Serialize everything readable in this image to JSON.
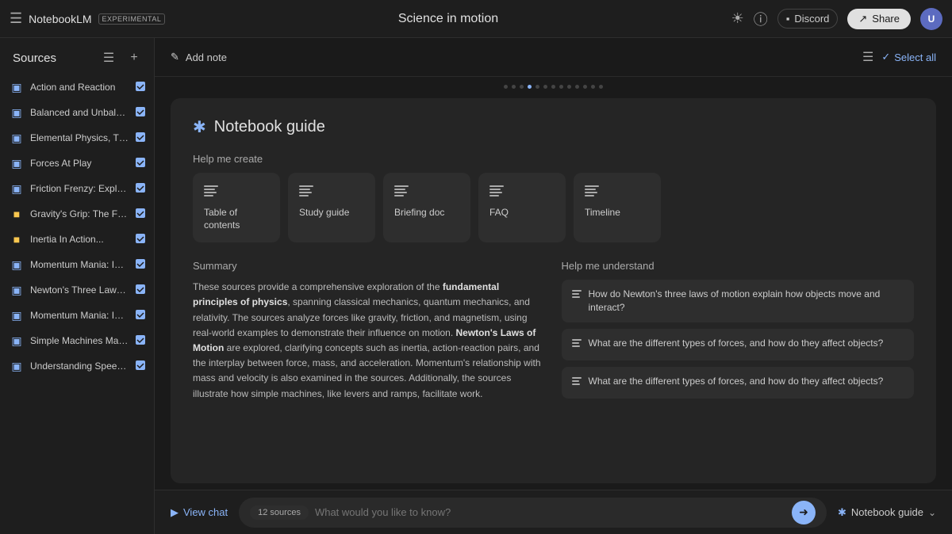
{
  "app": {
    "name": "NotebookLM",
    "badge": "EXPERIMENTAL",
    "notebook_title": "Science in motion",
    "discord_label": "Discord",
    "share_label": "Share",
    "avatar_initials": "U"
  },
  "sidebar": {
    "title": "Sources",
    "sources": [
      {
        "id": 1,
        "label": "Action and Reaction",
        "icon": "doc",
        "checked": true
      },
      {
        "id": 2,
        "label": "Balanced and Unbalance...",
        "icon": "doc",
        "checked": true
      },
      {
        "id": 3,
        "label": "Elemental Physics, Third...",
        "icon": "doc",
        "checked": true
      },
      {
        "id": 4,
        "label": "Forces At Play",
        "icon": "doc",
        "checked": true
      },
      {
        "id": 5,
        "label": "Friction Frenzy: Explorin...",
        "icon": "doc",
        "checked": true
      },
      {
        "id": 6,
        "label": "Gravity's Grip: The Force...",
        "icon": "yellow",
        "checked": true
      },
      {
        "id": 7,
        "label": "Inertia In Action...",
        "icon": "yellow",
        "checked": true
      },
      {
        "id": 8,
        "label": "Momentum Mania: Inves...",
        "icon": "doc",
        "checked": true
      },
      {
        "id": 9,
        "label": "Newton's Three Laws...",
        "icon": "doc",
        "checked": true
      },
      {
        "id": 10,
        "label": "Momentum Mania: Inves...",
        "icon": "doc",
        "checked": true
      },
      {
        "id": 11,
        "label": "Simple Machines Make...",
        "icon": "doc",
        "checked": true
      },
      {
        "id": 12,
        "label": "Understanding Speed, Ve...",
        "icon": "doc",
        "checked": true
      }
    ]
  },
  "topbar": {
    "add_note_label": "Add note",
    "select_all_label": "Select all"
  },
  "guide": {
    "title": "Notebook guide",
    "help_create_label": "Help me create",
    "create_options": [
      {
        "id": "toc",
        "label": "Table of contents",
        "icon": "☰"
      },
      {
        "id": "study",
        "label": "Study guide",
        "icon": "☰"
      },
      {
        "id": "brief",
        "label": "Briefing doc",
        "icon": "☰"
      },
      {
        "id": "faq",
        "label": "FAQ",
        "icon": "☰"
      },
      {
        "id": "timeline",
        "label": "Timeline",
        "icon": "☰"
      }
    ],
    "summary_label": "Summary",
    "summary_text_parts": {
      "intro": "These sources provide a comprehensive exploration of the ",
      "bold1": "fundamental principles of physics",
      "mid": ", spanning classical mechanics, quantum mechanics, and relativity. The sources analyze forces like gravity, friction, and magnetism, using real-world examples to demonstrate their influence on motion. ",
      "bold2": "Newton's Laws of Motion",
      "end": " are explored, clarifying concepts such as inertia, action-reaction pairs, and the interplay between force, mass, and acceleration. Momentum's relationship with mass and velocity is also examined in the sources. Additionally, the sources illustrate how simple machines, like levers and ramps, facilitate work."
    },
    "understand_label": "Help me understand",
    "understand_items": [
      {
        "id": 1,
        "text": "How do Newton's three laws of motion explain how objects move and interact?"
      },
      {
        "id": 2,
        "text": "What are the different types of forces, and how do they affect objects?"
      },
      {
        "id": 3,
        "text": "What are the different types of forces, and how do they affect objects?"
      }
    ]
  },
  "bottombar": {
    "view_chat_label": "View chat",
    "sources_count_label": "12 sources",
    "input_placeholder": "What would you like to know?",
    "notebook_guide_label": "Notebook guide"
  }
}
